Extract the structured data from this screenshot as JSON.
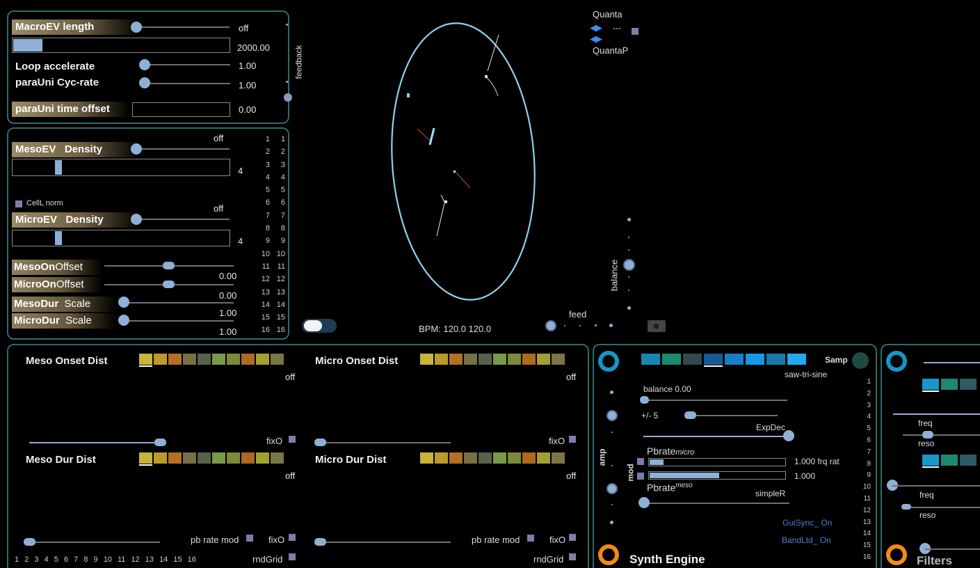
{
  "macro": {
    "length_label": "MacroEV length",
    "length_state": "off",
    "length_value": "2000.00",
    "loop_label": "Loop  accelerate",
    "loop_value": "1.00",
    "cycrate_label": "paraUni  Cyc-rate",
    "cycrate_value": "1.00",
    "offset_label": "paraUni time offset",
    "offset_value": "0.00",
    "feedback_label": "feedback"
  },
  "meso": {
    "density_state": "off",
    "density_label_a": "MesoEV",
    "density_label_b": "Density",
    "density_value": "4",
    "celll_label": "CellL norm",
    "micro_state": "off",
    "micro_label_a": "MicroEV",
    "micro_label_b": "Density",
    "micro_value": "4",
    "mesoon_a": "Meso",
    "mesoon_b": "On",
    "mesoon_c": "Offset",
    "mesoon_value": "0.00",
    "microon_a": "Micro",
    "microon_b": "On",
    "microon_c": "Offset",
    "microon_value": "0.00",
    "mesodur_a": "MesoDur",
    "mesodur_b": "Scale",
    "mesodur_value": "1.00",
    "microdur_a": "MicroDur",
    "microdur_b": "Scale",
    "microdur_value": "1.00",
    "row_numbers": [
      "1",
      "2",
      "3",
      "4",
      "5",
      "6",
      "7",
      "8",
      "9",
      "10",
      "11",
      "12",
      "13",
      "14",
      "15",
      "16"
    ]
  },
  "center": {
    "quanta_label": "Quanta",
    "quanta_value": "---",
    "quantap_label": "QuantaP",
    "balance_label": "balance",
    "feed_label": "feed",
    "bpm_label": "BPM: 120.0 120.0"
  },
  "dist": {
    "meso_onset_title": "Meso Onset Dist",
    "meso_onset_state": "off",
    "micro_onset_title": "Micro Onset Dist",
    "micro_onset_state": "off",
    "fix_label": "fixO",
    "meso_dur_title": "Meso Dur  Dist",
    "meso_dur_state": "off",
    "micro_dur_title": "Micro Dur Dist",
    "micro_dur_state": "off",
    "pbrate_label": "pb rate mod",
    "rndgrid_label": "rndGrid",
    "bottom_numbers": [
      "1",
      "2",
      "3",
      "4",
      "5",
      "6",
      "7",
      "8",
      "9",
      "10",
      "11",
      "12",
      "13",
      "14",
      "15",
      "16"
    ],
    "palette": [
      "#c7b43a",
      "#bb9a2a",
      "#b46f24",
      "#767044",
      "#56634a",
      "#799a48",
      "#7c8a3c",
      "#ad6a20",
      "#a3a033",
      "#7a7546"
    ]
  },
  "synth": {
    "title": "Synth Engine",
    "samp_label": "Samp",
    "waveform": "saw-tri-sine",
    "balance_label": "balance 0.00",
    "plusminus_label": "+/- 5",
    "expdec_label": "ExpDec",
    "pbrate_micro_a": "Pbrate",
    "pbrate_micro_b": "micro",
    "pbrate_micro_value": "1.000 frq rat",
    "pbrate_meso_value": "1.000",
    "pbrate_meso_a": "Pbrate",
    "pbrate_meso_b": "meso",
    "simpler_label": "simpleR",
    "amp_label": "amp",
    "mod_label": "mod",
    "guisync_label": "GuiSync_ On",
    "bandltd_label": "BandLtd_ On",
    "palette": [
      "#1a86b0",
      "#1a8a6e",
      "#33474f",
      "#1a5a98",
      "#1580c8",
      "#1598e6",
      "#1a7aa6",
      "#21a8f0"
    ],
    "numbers": [
      "1",
      "2",
      "3",
      "4",
      "5",
      "6",
      "7",
      "8",
      "9",
      "10",
      "11",
      "12",
      "13",
      "14",
      "15",
      "16"
    ]
  },
  "filters": {
    "title": "Filters",
    "freq_label": "freq",
    "reso_label": "reso",
    "palette": [
      "#1a96c8",
      "#1a8a6e",
      "#2e5a62"
    ]
  }
}
